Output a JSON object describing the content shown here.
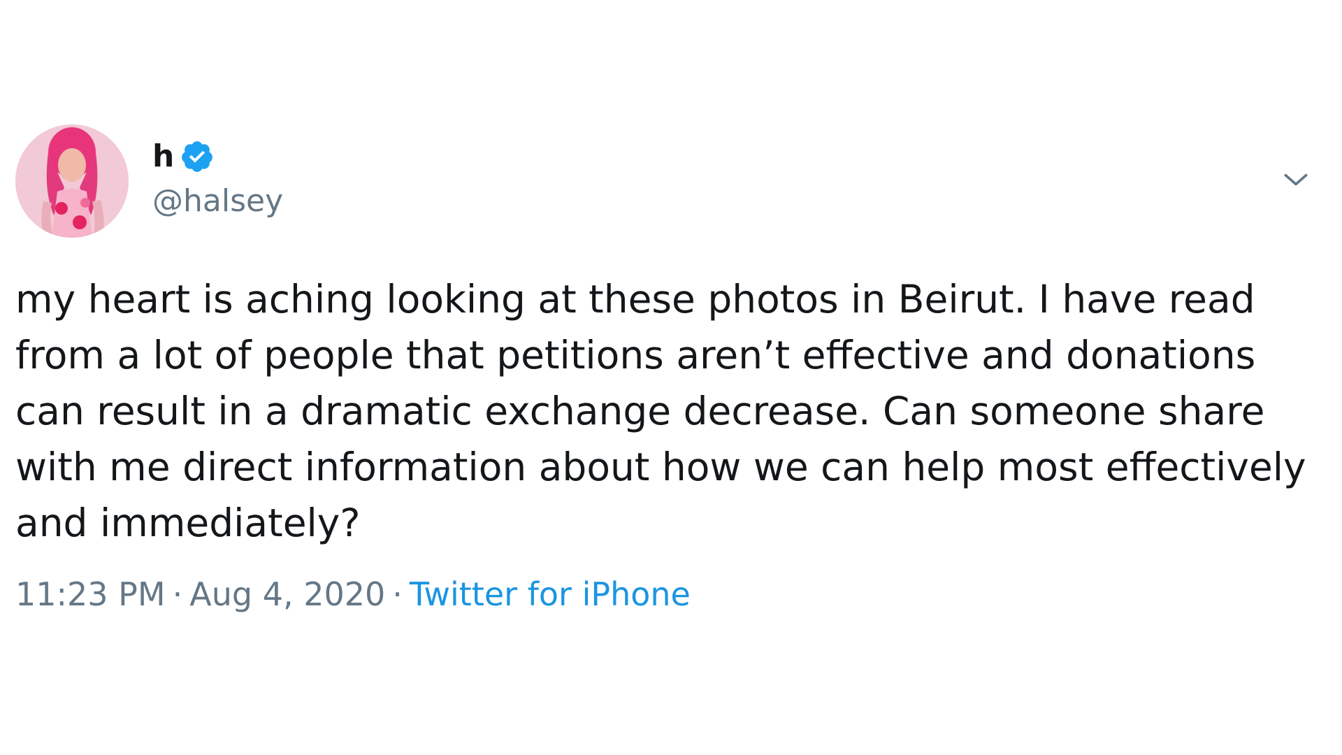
{
  "tweet": {
    "display_name": "h",
    "handle": "@halsey",
    "avatar_icon": "profile-photo",
    "verified_icon": "verified-badge-icon",
    "more_icon": "chevron-down-icon",
    "text": "my heart is aching looking at these photos in Beirut. I have read from a lot of people that petitions aren’t effective and donations can result in a dramatic exchange decrease. Can someone share with me direct information about how we can help most effectively and immediately?",
    "time": "11:23 PM",
    "separator": "·",
    "date": "Aug 4, 2020",
    "source": "Twitter for iPhone"
  },
  "colors": {
    "text": "#14171a",
    "secondary": "#657786",
    "link": "#1b95e0",
    "verified": "#1da1f2"
  }
}
